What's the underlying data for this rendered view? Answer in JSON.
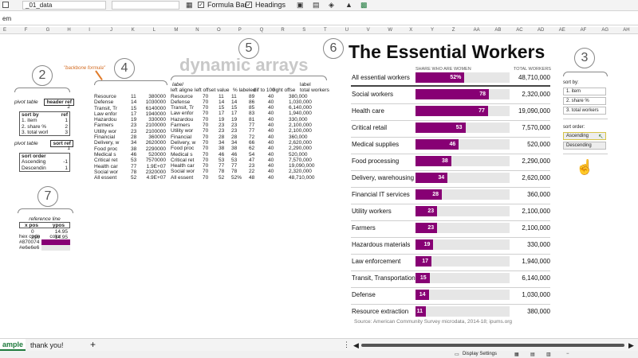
{
  "toolbar": {
    "name_box": "_01_data",
    "formula_bar_label": "Formula Bar",
    "headings_label": "Headings"
  },
  "formula_bar": {
    "cell_ref": "em"
  },
  "columns": [
    "E",
    "F",
    "G",
    "H",
    "I",
    "J",
    "K",
    "L",
    "M",
    "N",
    "O",
    "P",
    "Q",
    "R",
    "S",
    "T",
    "U",
    "V",
    "W",
    "X",
    "Y",
    "Z",
    "AA",
    "AB",
    "AC",
    "AD",
    "AE",
    "AF",
    "AG",
    "AH"
  ],
  "callouts": [
    "2",
    "4",
    "5",
    "6",
    "3",
    "7"
  ],
  "annotations": {
    "backbone_formula": "\"backbone formula\"",
    "dynamic_arrays": "dynamic arrays"
  },
  "pivot_block": {
    "pivot_table_label": "pivot table",
    "header_ref_label": "header ref",
    "header_ref_value": "2",
    "sort_by_label": "sort by",
    "ref_label": "ref",
    "sort_by_rows": [
      [
        "1. item",
        "1"
      ],
      [
        "2. share %",
        "2"
      ],
      [
        "3. total worl",
        "3"
      ]
    ],
    "sort_ref_label": "sort ref",
    "sort_ref_value": "1",
    "sort_order_label": "sort order",
    "sort_order_rows": [
      [
        "Ascending",
        "-1"
      ],
      [
        "Descendin",
        "1"
      ]
    ]
  },
  "reference_block": {
    "title": "reference line",
    "xpos_label": "x pos",
    "ypos_label": "ypos",
    "rows": [
      [
        "0",
        "14.95"
      ],
      [
        "210",
        "14.95"
      ]
    ],
    "hex_label": "hex code",
    "color_label": "color",
    "hex_rows": [
      [
        "#870074",
        "#870074"
      ],
      [
        "#e6e6e6",
        "#e6e6e6"
      ]
    ]
  },
  "data_block_k": {
    "rows": [
      [
        "Resource",
        "11",
        "380000"
      ],
      [
        "Defense",
        "14",
        "1030000"
      ],
      [
        "Transit, Tr",
        "15",
        "6140000"
      ],
      [
        "Law enfor",
        "17",
        "1940000"
      ],
      [
        "Hazardou",
        "19",
        "330000"
      ],
      [
        "Farmers",
        "23",
        "2100000"
      ],
      [
        "Utility wor",
        "23",
        "2100000"
      ],
      [
        "Financial",
        "28",
        "360000"
      ],
      [
        "Delivery, w",
        "34",
        "2620000"
      ],
      [
        "Food proc",
        "38",
        "2290000"
      ],
      [
        "Medical s",
        "46",
        "520000"
      ],
      [
        "Critical ret",
        "53",
        "7570000"
      ],
      [
        "Health car",
        "77",
        "1.9E+07"
      ],
      [
        "Social wor",
        "78",
        "2320000"
      ],
      [
        "All essent",
        "52",
        "4.9E+07"
      ]
    ]
  },
  "data_block_o": {
    "header_label": "label",
    "header_label2": "label",
    "headers": [
      "left aligne",
      "left offset",
      "value",
      "% labeled",
      "dif to 100",
      "right offse",
      "total workers"
    ],
    "rows": [
      [
        "Resource",
        "70",
        "11",
        "11",
        "89",
        "40",
        "380,000"
      ],
      [
        "Defense",
        "70",
        "14",
        "14",
        "86",
        "40",
        "1,030,000"
      ],
      [
        "Transit, Tr",
        "70",
        "15",
        "15",
        "85",
        "40",
        "6,140,000"
      ],
      [
        "Law enfor",
        "70",
        "17",
        "17",
        "83",
        "40",
        "1,940,000"
      ],
      [
        "Hazardou",
        "70",
        "19",
        "19",
        "81",
        "40",
        "330,000"
      ],
      [
        "Farmers",
        "70",
        "23",
        "23",
        "77",
        "40",
        "2,100,000"
      ],
      [
        "Utility wor",
        "70",
        "23",
        "23",
        "77",
        "40",
        "2,100,000"
      ],
      [
        "Financial",
        "70",
        "28",
        "28",
        "72",
        "40",
        "360,000"
      ],
      [
        "Delivery, w",
        "70",
        "34",
        "34",
        "66",
        "40",
        "2,620,000"
      ],
      [
        "Food proc",
        "70",
        "38",
        "38",
        "62",
        "40",
        "2,290,000"
      ],
      [
        "Medical s",
        "70",
        "46",
        "46",
        "54",
        "40",
        "520,000"
      ],
      [
        "Critical ret",
        "70",
        "53",
        "53",
        "47",
        "40",
        "7,570,000"
      ],
      [
        "Health car",
        "70",
        "77",
        "77",
        "23",
        "40",
        "19,090,000"
      ],
      [
        "Social wor",
        "70",
        "78",
        "78",
        "22",
        "40",
        "2,320,000"
      ],
      [
        "All essent",
        "70",
        "52",
        "52%",
        "48",
        "40",
        "48,710,000"
      ]
    ]
  },
  "chart": {
    "title": "The Essential Workers",
    "col_share": "SHARE WHO ARE WOMEN",
    "col_total": "TOTAL WORKERS",
    "bar_color": "#870074",
    "track_color": "#e6e6e6",
    "source": "Source: American Community Survey microdata, 2014-18; ipums.org",
    "rows": [
      {
        "label": "All essential workers",
        "value": 52,
        "value_label": "52%",
        "total": "48,710,000"
      },
      {
        "label": "Social workers",
        "value": 78,
        "value_label": "78",
        "total": "2,320,000"
      },
      {
        "label": "Health care",
        "value": 77,
        "value_label": "77",
        "total": "19,090,000"
      },
      {
        "label": "Critical retail",
        "value": 53,
        "value_label": "53",
        "total": "7,570,000"
      },
      {
        "label": "Medical supplies",
        "value": 46,
        "value_label": "46",
        "total": "520,000"
      },
      {
        "label": "Food processing",
        "value": 38,
        "value_label": "38",
        "total": "2,290,000"
      },
      {
        "label": "Delivery, warehousing",
        "value": 34,
        "value_label": "34",
        "total": "2,620,000"
      },
      {
        "label": "Financial IT services",
        "value": 28,
        "value_label": "28",
        "total": "360,000"
      },
      {
        "label": "Utility workers",
        "value": 23,
        "value_label": "23",
        "total": "2,100,000"
      },
      {
        "label": "Farmers",
        "value": 23,
        "value_label": "23",
        "total": "2,100,000"
      },
      {
        "label": "Hazardous materials",
        "value": 19,
        "value_label": "19",
        "total": "330,000"
      },
      {
        "label": "Law enforcement",
        "value": 17,
        "value_label": "17",
        "total": "1,940,000"
      },
      {
        "label": "Transit, Transportation",
        "value": 15,
        "value_label": "15",
        "total": "6,140,000"
      },
      {
        "label": "Defense",
        "value": 14,
        "value_label": "14",
        "total": "1,030,000"
      },
      {
        "label": "Resource extraction",
        "value": 11,
        "value_label": "11",
        "total": "380,000"
      }
    ]
  },
  "controls": {
    "sort_by_label": "sort by:",
    "sort_by_options": [
      "1. item",
      "2. share %",
      "3. total workers"
    ],
    "sort_order_label": "sort order:",
    "sort_order_options": [
      "Ascending",
      "Descending"
    ],
    "selected_sort_order": "Ascending"
  },
  "tabs": {
    "active": "ample",
    "other": "thank you!",
    "add": "+"
  },
  "status": {
    "display_settings": "Display Settings"
  }
}
